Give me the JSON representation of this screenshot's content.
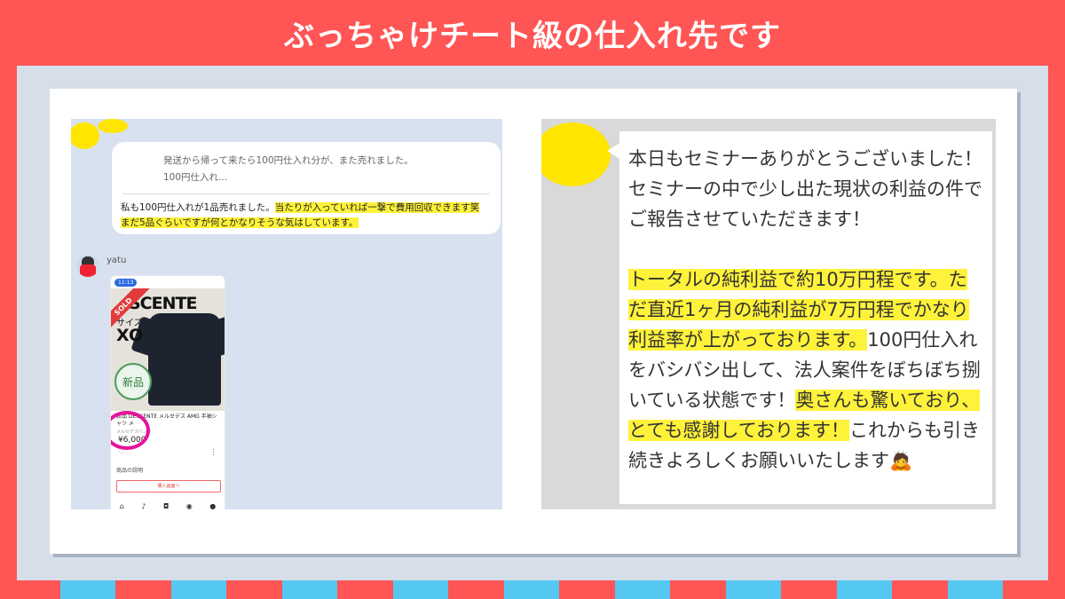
{
  "header": {
    "title": "ぶっちゃけチート級の仕入れ先です"
  },
  "left_chat": {
    "quote_line1": "発送から帰って来たら100円仕入れ分が、また売れました。",
    "quote_line2": "100円仕入れ...",
    "msg_plain_1": "私も100円仕入れが1品売れました。",
    "msg_hl_1": "当たりが入っていれば一撃で費用回収できます笑",
    "msg_hl_2": "まだ5品ぐらいですが何とかなりそうな気はしています。",
    "username": "yatu",
    "phone": {
      "time": "11:13",
      "sold": "SOLD",
      "brand": "SCENTE",
      "size_label": "サイズ",
      "size": "XO",
      "condition": "新品",
      "title": "新品 DESCENTE メルセデス AMG 半袖シャツ メ",
      "subtitle": "メルセデスベンツ",
      "price": "¥6,000",
      "desc_label": "商品の説明",
      "buy_label": "購入画面へ"
    },
    "colors": {
      "highlight": "#fff23a",
      "ring": "#e6139b",
      "mask": "#ffe500"
    }
  },
  "right_chat": {
    "p1": "本日もセミナーありがとうございました！セミナーの中で少し出た現状の利益の件でご報告させていただきます！",
    "p2_hl": "トータルの純利益で約10万円程です。ただ直近1ヶ月の純利益が7万円程でかなり利益率が上がっております。",
    "p2_plain": "100円仕入れをバシバシ出して、法人案件をぼちぼち捌いている状態です！",
    "p2_hl2": "奥さんも驚いており、とても感謝しております！",
    "p2_end": "これからも引き続きよろしくお願いいたします🙇"
  }
}
